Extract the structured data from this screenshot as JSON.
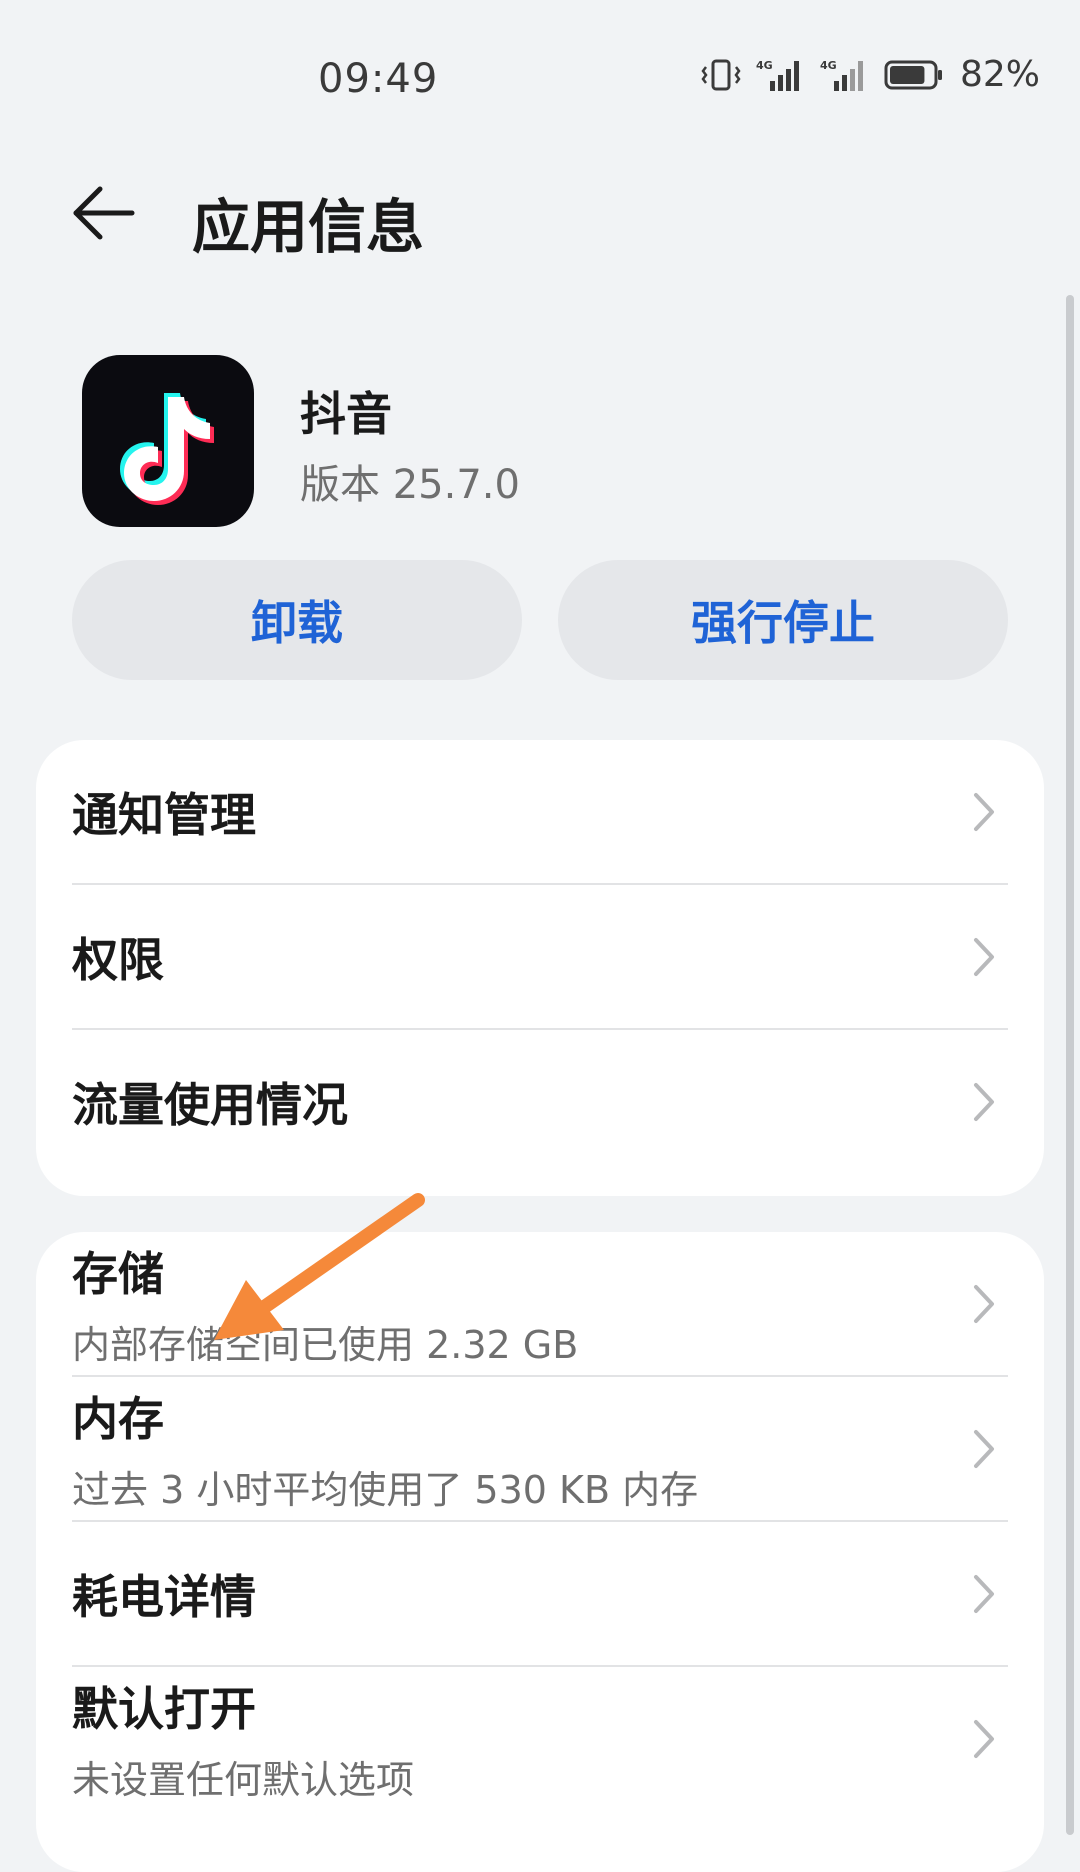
{
  "status_bar": {
    "time": "09:49",
    "network_1": "4G",
    "network_2": "4G",
    "battery_percent": "82%",
    "battery_level": 0.82
  },
  "header": {
    "title": "应用信息"
  },
  "app": {
    "name": "抖音",
    "version": "版本 25.7.0"
  },
  "actions": {
    "uninstall": "卸载",
    "force_stop": "强行停止"
  },
  "card_primary": {
    "items": [
      {
        "label": "通知管理"
      },
      {
        "label": "权限"
      },
      {
        "label": "流量使用情况"
      }
    ]
  },
  "card_secondary": {
    "items": [
      {
        "label": "存储",
        "detail": "内部存储空间已使用 2.32 GB"
      },
      {
        "label": "内存",
        "detail": "过去 3 小时平均使用了 530 KB 内存"
      },
      {
        "label": "耗电详情"
      },
      {
        "label": "默认打开",
        "detail": "未设置任何默认选项"
      }
    ]
  },
  "colors": {
    "accent": "#1f63d6",
    "annotation_arrow": "#f5893a",
    "background": "#f1f3f5"
  }
}
